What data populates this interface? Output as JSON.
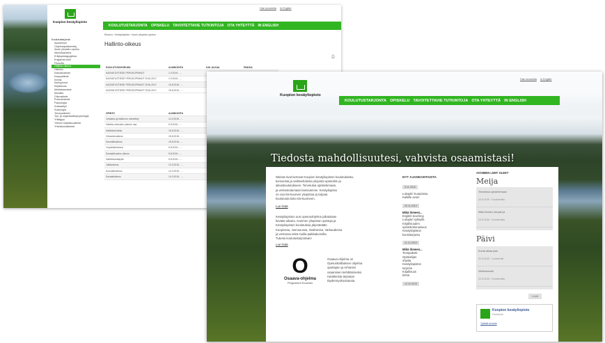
{
  "back_page": {
    "top_links": [
      "Hae sivustolta",
      "In English"
    ],
    "logo_text": "Kuopion kesäyliopisto",
    "nav": [
      "KOULUTUSTARJONTA",
      "OPISKELU",
      "TAVOITETTAVIE TUTKINTOJA",
      "OTA YHTEYTTÄ",
      "IN ENGLISH"
    ],
    "breadcrumb": "Etusivu › Kesäyliopisto › Avoin yliopisto-opetus",
    "title": "Hallinto-oikeus",
    "sidebar": [
      {
        "label": "Koulutustarjonta",
        "type": "head"
      },
      {
        "label": "Alueellinen"
      },
      {
        "label": "Ohjelmatyöskentely"
      },
      {
        "label": "Avoin yliopisto-opetus"
      },
      {
        "label": "Aikuiskasvatus"
      },
      {
        "label": "Erityispedagogiikka"
      },
      {
        "label": "Englannin kieli"
      },
      {
        "label": "Filosofia"
      },
      {
        "label": "Hallinto-oikeus",
        "type": "sel"
      },
      {
        "label": "Historia"
      },
      {
        "label": "Kasvatustiede"
      },
      {
        "label": "Kauppatiede"
      },
      {
        "label": "Kemia"
      },
      {
        "label": "Kieliopinnot"
      },
      {
        "label": "Kirjallisuus"
      },
      {
        "label": "Mediakasvatus"
      },
      {
        "label": "Musiikki"
      },
      {
        "label": "Oikeustiede"
      },
      {
        "label": "Puheviestintä"
      },
      {
        "label": "Psykologia"
      },
      {
        "label": "Sosiaalityö"
      },
      {
        "label": "Sosiologia"
      },
      {
        "label": "Terveystieteet"
      },
      {
        "label": "Työ- ja organisaatiopsykologia"
      },
      {
        "label": "Yrittäjyys"
      },
      {
        "label": "Yleinen kirjallisuustiede"
      },
      {
        "label": "Yhteiskuntatieteet"
      }
    ],
    "table1": {
      "headers": [
        "KOULUTUSOHJELMA",
        "AJANKOHTA",
        "ILM. ALKAA",
        "PAIKKA"
      ],
      "rows": [
        [
          "KASVATUSTIEDE PERUSOPINNOT",
          "1.9.2015 - ...",
          "",
          ""
        ],
        [
          "KASVATUSTIEDE PERUSOPINNOT 2016-2017",
          "1.9.2016 - ...",
          "",
          ""
        ],
        [
          "KASVATUSTIEDE PERUSOPINNOT 2016-2017",
          "15.8.2016 - ...",
          "",
          ""
        ],
        [
          "KASVATUSTIEDE PERUSOPINNOT 2016-2017",
          "15.8.2016 - ...",
          "",
          ""
        ]
      ]
    },
    "table2": {
      "headers": [
        "OPINTO",
        "AJANKOHTA"
      ],
      "rows": [
        [
          "Johdatus ja hallinnon menettely",
          "14.3.2016 - ..."
        ],
        [
          "Hallinto-oikeuden yleinen osa",
          "5.8.2016 - ..."
        ],
        [
          "Hallintotoiminta",
          "15.8.2016 - ..."
        ],
        [
          "Virkamiesoikeus",
          "15.8.2016 - ..."
        ],
        [
          "Kunnallisoikeus",
          "15.8.2016 - ..."
        ],
        [
          "Ympäristöoikeus",
          "5.8.2016 - ..."
        ],
        [
          "Sosiaalihuollon oikeus",
          "5.8.2016 - ..."
        ],
        [
          "Hallintolainkäyttö",
          "5.8.2016 - ..."
        ],
        [
          "Julkisoikeus",
          "14.3.2016 - ..."
        ],
        [
          "Kunnallisoikeus",
          "14.3.2016 - ..."
        ],
        [
          "Sosiaalioikeus",
          "14.3.2016 - ..."
        ]
      ]
    }
  },
  "front_page": {
    "top_links": [
      "Hae sivustolta",
      "In English"
    ],
    "logo_text": "Kuopion kesäyliopisto",
    "nav": [
      "KOULUTUSTARJONTA",
      "OPISKELU",
      "TAVOITETTAVIE TUTKINTOJA",
      "OTA YHTEYTTÄ",
      "IN ENGLISH"
    ],
    "slogan": "Tiedosta mahdollisuutesi, vahvista osaamistasi!",
    "intro_lines": [
      "Näissä sivut kertovat Kuopion kesäyliopiston koulutuksista,",
      "kursseista ja vaihtoehdoista yliopisto-opintoihin ja",
      "aikuiskoulutukseen. Tervetuloa opiskelemaan,",
      "ja verkostoitumaan kanssamme. Kesäyliopisto",
      "on osa Itä-Suomen yliopistoa ja tarjoaa",
      "koulutusta koko Itä-Suomeen."
    ],
    "read_more_1": "Lue lisää",
    "second_para_lines": [
      "Kesäyliopiston uusi opetusohjelma julkaistaan",
      "kevään aikana. Avoimen yliopiston opintoja ja",
      "Kesäyliopiston koulutuksia järjestetään",
      "Kuopiossa, Joensuussa, Iisalmessa, Varkaudessa",
      "ja verkossa sekä muilla paikkakunnilla.",
      "Tutustu koulutustarjontaan!"
    ],
    "read_more_2": "Lue lisää",
    "ossaava": {
      "letter": "O",
      "title": "Osaava-ohjelma",
      "subtitle": "Programmi Koulutus",
      "lines": [
        "Osaava-ohjelma on",
        "Opetushallituksen ohjelma",
        "opettajien ja rehtorien",
        "osaamisen kehittämiseksi.",
        "Hankkeista tarjotaan",
        "täydennyskoulutusta."
      ]
    },
    "news": {
      "heading": "NYT AJANKOHTAISTA",
      "items": [
        {
          "date": "5.11.2015",
          "lines": [
            "Lukupiiri Kuopiossa",
            "Kaikille avoin"
          ]
        },
        {
          "date": "20.11.2015",
          "title": "Mikä ihmeen...",
          "lines": [
            "English teaching",
            "Lukupiiri syksyllä",
            "Kirjallisuuden",
            "opintokokonaisuus",
            "Kesäyliopiston",
            "kurssitarjonta"
          ]
        },
        {
          "date": "11.12.2015",
          "title": "Mikä ihmeen...",
          "lines": [
            "Tietopaketti",
            "Opiskelijan",
            "ohjeita",
            "Kesäyliopiston",
            "tarjonta",
            "Kirjallisuus",
            "tietoa"
          ]
        },
        {
          "date": "12.12.2015",
          "lines": []
        }
      ]
    },
    "right": {
      "heading": "AVOIMEN LIMIT OLEET",
      "section1_title": "Meija",
      "box1": [
        {
          "text": "Tervetuloa opiskelemaan",
          "meta": "15.10.2015 · 0 kommenttia"
        },
        {
          "text": "Mikä ihmeen lukupiiri ja",
          "meta": "15.10.2015 · 0 kommenttia"
        }
      ],
      "section2_title": "Päivi",
      "box2": [
        {
          "text": "Kurssi alkaa pian",
          "meta": "22.10.2015 · 1 kommentti"
        },
        {
          "text": "Verkkokurssit",
          "meta": "22.10.2015 · 0 kommenttia"
        }
      ],
      "more_button": "Lisää",
      "facebook": {
        "name": "Kuopion kesäyliopisto",
        "sub": "Facebook",
        "line": "Tykkää sivusta"
      }
    }
  }
}
